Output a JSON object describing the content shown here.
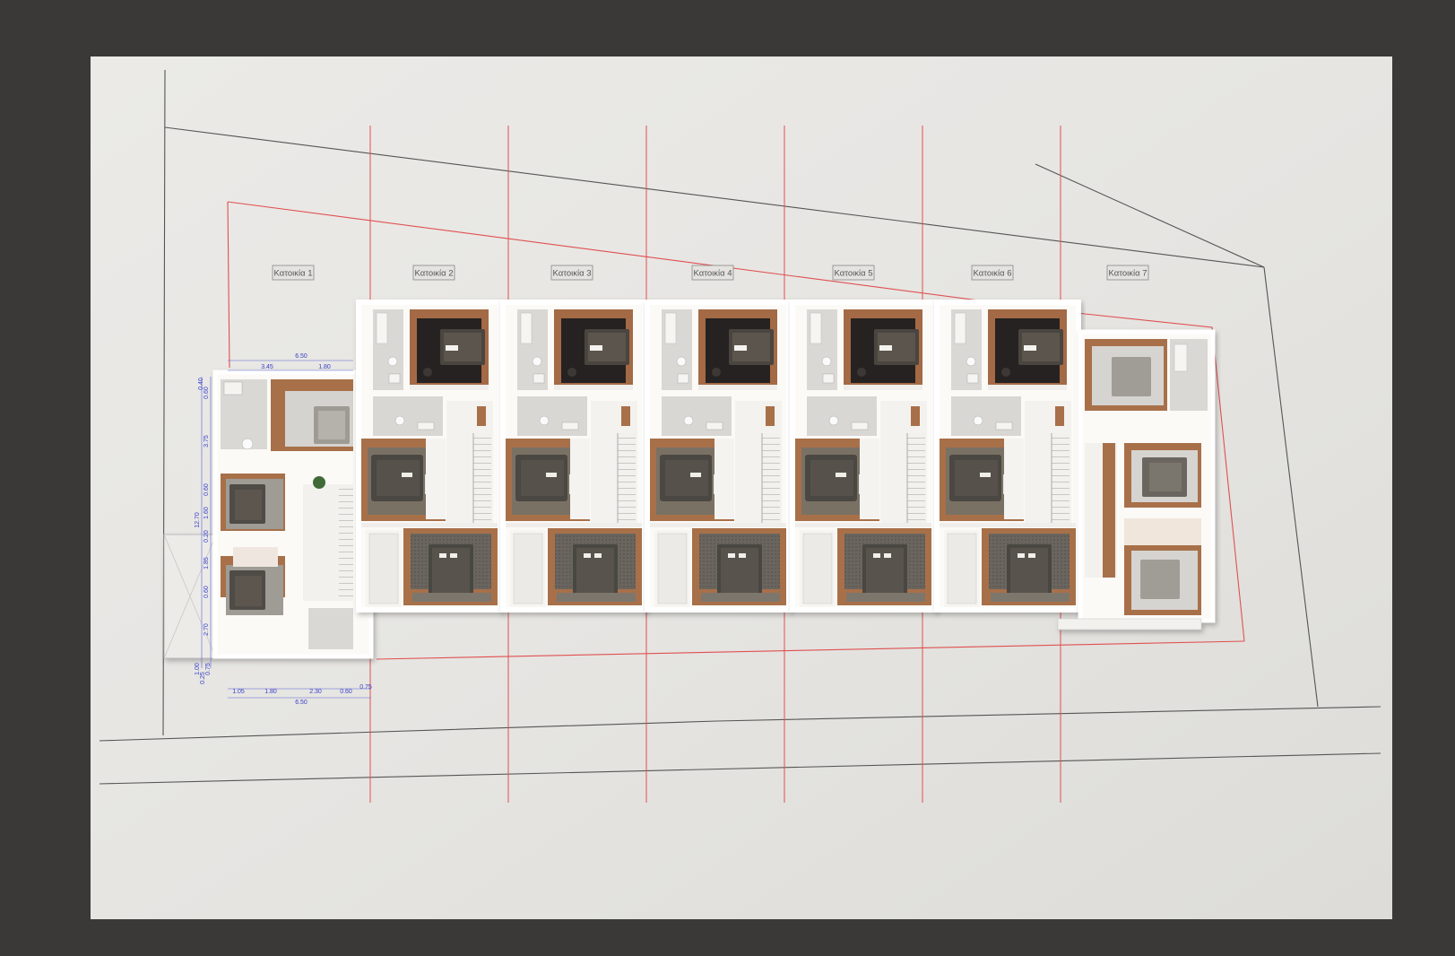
{
  "houses": [
    {
      "label": "Κατοικία 1"
    },
    {
      "label": "Κατοικία 2"
    },
    {
      "label": "Κατοικία 3"
    },
    {
      "label": "Κατοικία 4"
    },
    {
      "label": "Κατοικία 5"
    },
    {
      "label": "Κατοικία 6"
    },
    {
      "label": "Κατοικία 7"
    }
  ],
  "dimensions": {
    "top_total": "6.50",
    "top_a": "3.45",
    "top_b": "1.80",
    "left_a": "0.40",
    "left_b": "0.60",
    "left_c": "3.75",
    "left_d": "0.60",
    "left_e": "1.60",
    "left_total": "12.70",
    "left_f": "0.20",
    "left_g": "1.85",
    "left_h": "0.60",
    "left_i": "2.70",
    "left_j": "1.00",
    "left_k": "0.25",
    "left_l": "0.75",
    "bottom_a": "1.05",
    "bottom_b": "1.80",
    "bottom_c": "2.30",
    "bottom_d": "0.60",
    "bottom_e": "0.75",
    "bottom_total": "6.50"
  },
  "colors": {
    "background": "#3a3938",
    "paper": "#e9e8e5",
    "wall": "#fbfaf7",
    "wood": "#a86f48",
    "dark_floor": "#262422",
    "rug": "#6b665f",
    "plot_line": "#e05050",
    "dimension": "#3a40c8"
  }
}
